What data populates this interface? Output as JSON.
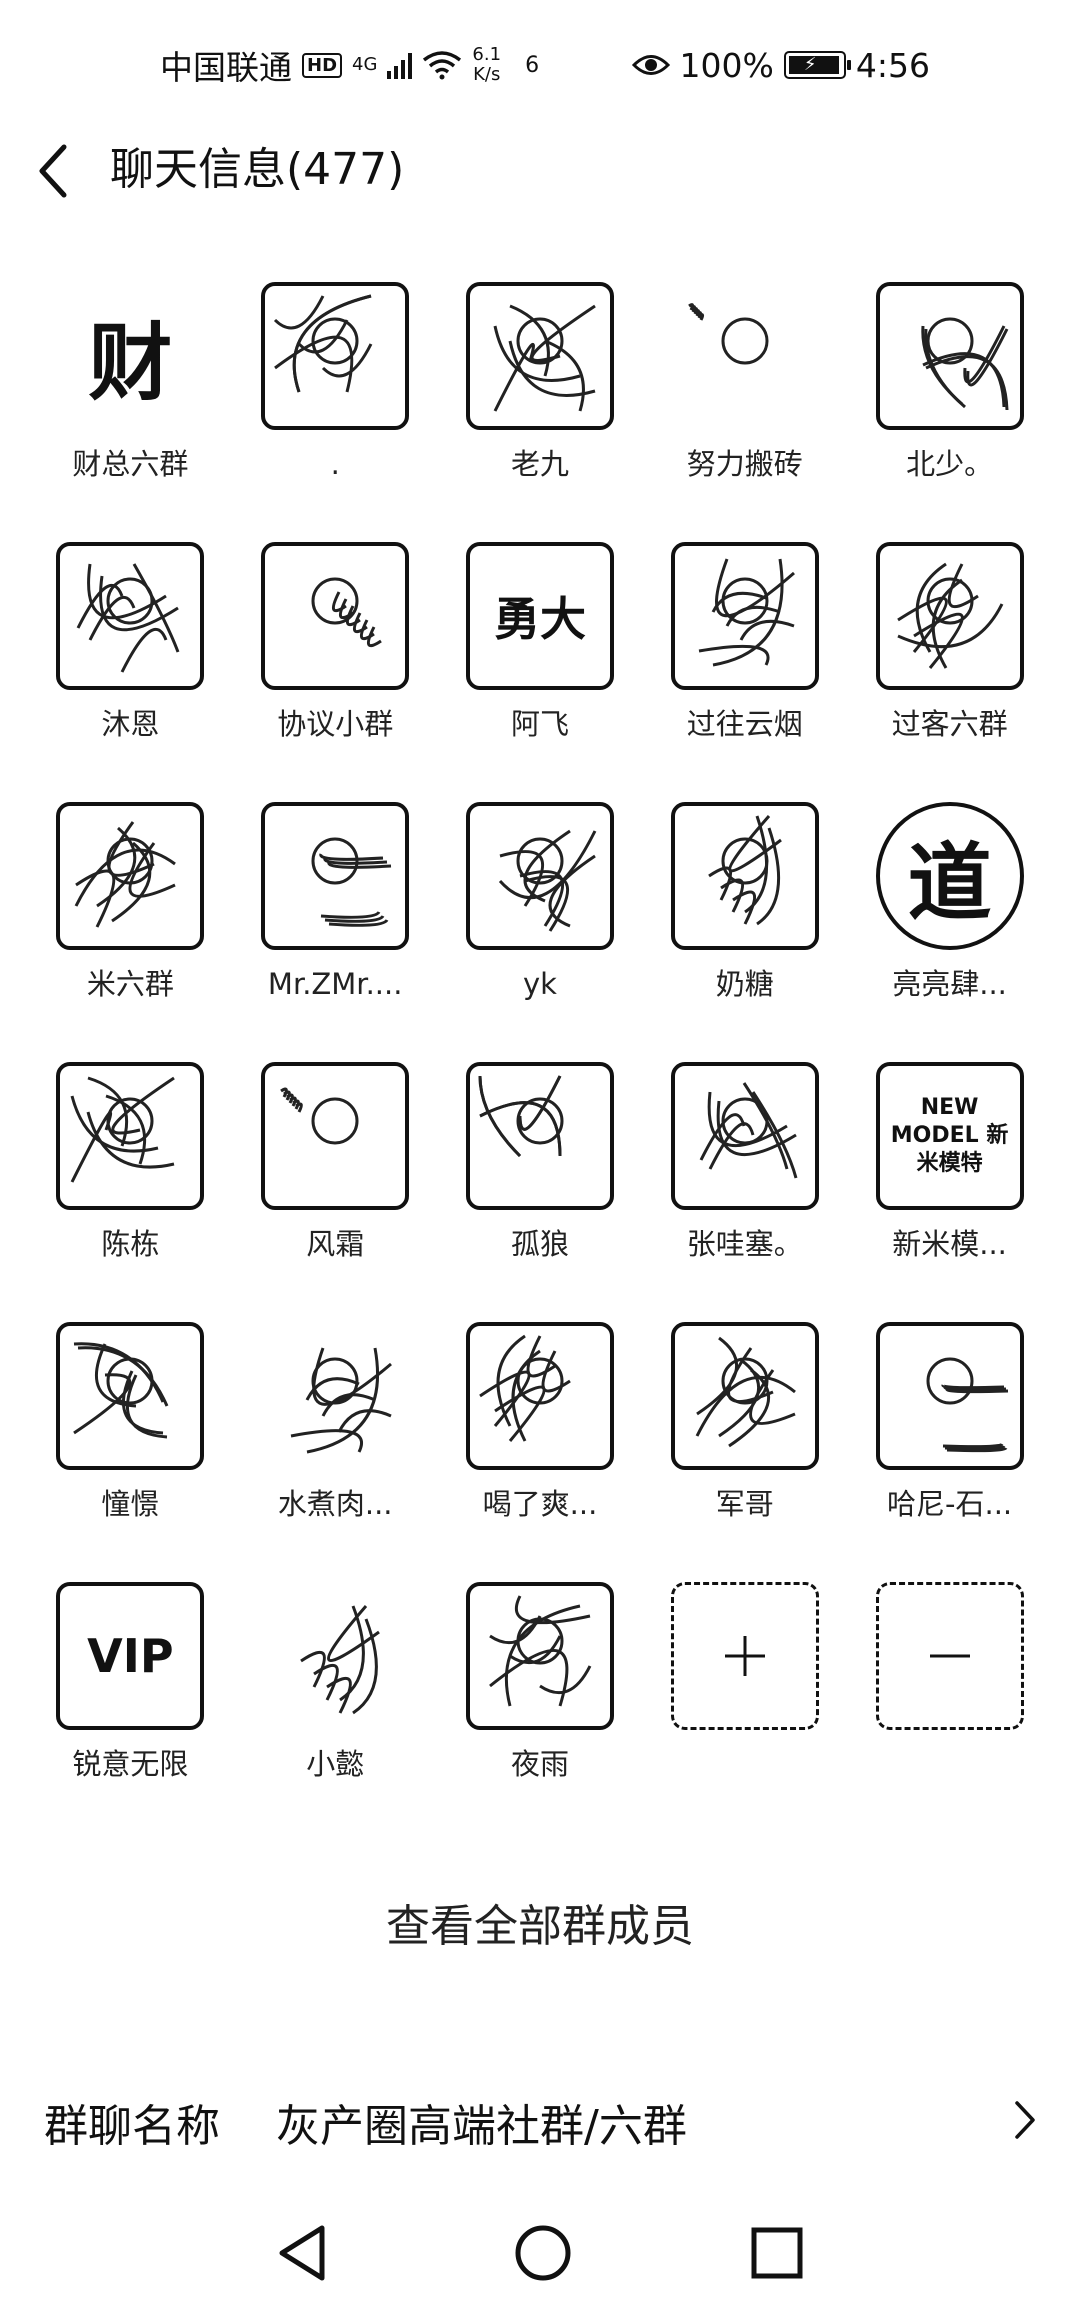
{
  "status_bar": {
    "carrier": "中国联通",
    "hd": "HD",
    "network": "4G",
    "speed_value": "6.1",
    "speed_unit": "K/s",
    "notification_count": "6",
    "battery_percent": "100%",
    "battery_level": 1.0,
    "time": "4:56"
  },
  "header": {
    "title": "聊天信息(477)"
  },
  "members": [
    {
      "name": "财总六群",
      "avatar_text": "财",
      "avatar_icon": "calligraphy-avatar-icon"
    },
    {
      "name": ".",
      "avatar_icon": "landscape-avatar-icon"
    },
    {
      "name": "老九",
      "avatar_icon": "street-photo-avatar-icon"
    },
    {
      "name": "努力搬砖",
      "avatar_icon": "baby-photo-avatar-icon"
    },
    {
      "name": "北少。",
      "avatar_icon": "pattern-avatar-icon"
    },
    {
      "name": "沐恩",
      "avatar_icon": "portrait-avatar-icon"
    },
    {
      "name": "协议小群",
      "avatar_icon": "calligraphy-avatar-icon"
    },
    {
      "name": "阿飞",
      "avatar_text": "勇大",
      "avatar_icon": "poster-avatar-icon"
    },
    {
      "name": "过往云烟",
      "avatar_icon": "crowd-photo-avatar-icon"
    },
    {
      "name": "过客六群",
      "avatar_icon": "landscape-avatar-icon"
    },
    {
      "name": "米六群",
      "avatar_icon": "geometric-avatar-icon"
    },
    {
      "name": "Mr.ZMr....",
      "avatar_icon": "sketch-avatar-icon"
    },
    {
      "name": "yk",
      "avatar_icon": "man-portrait-avatar-icon"
    },
    {
      "name": "奶糖",
      "avatar_icon": "child-with-bear-avatar-icon"
    },
    {
      "name": "亮亮肆...",
      "avatar_text": "道",
      "avatar_icon": "round-calligraphy-avatar-icon"
    },
    {
      "name": "陈栋",
      "avatar_icon": "man-glasses-avatar-icon"
    },
    {
      "name": "风霜",
      "avatar_icon": "eagle-avatar-icon"
    },
    {
      "name": "孤狼",
      "avatar_icon": "man-portrait-avatar-icon"
    },
    {
      "name": "张哇塞。",
      "avatar_icon": "cartoon-avatar-icon"
    },
    {
      "name": "新米模...",
      "avatar_text": "NEW MODEL 新米模特",
      "avatar_icon": "logo-avatar-icon"
    },
    {
      "name": "憧憬",
      "avatar_icon": "man-portrait-avatar-icon"
    },
    {
      "name": "水煮肉...",
      "avatar_icon": "cartoon-kid-avatar-icon"
    },
    {
      "name": "喝了爽...",
      "avatar_icon": "doraemon-avatar-icon"
    },
    {
      "name": "军哥",
      "avatar_icon": "smiling-man-avatar-icon"
    },
    {
      "name": "哈尼-石...",
      "avatar_icon": "beach-photo-avatar-icon"
    },
    {
      "name": "锐意无限",
      "avatar_text": "VIP",
      "avatar_icon": "vip-avatar-icon"
    },
    {
      "name": "小懿",
      "avatar_icon": "blank-avatar-icon"
    },
    {
      "name": "夜雨",
      "avatar_icon": "outdoor-photo-avatar-icon"
    }
  ],
  "actions": {
    "add_icon": "plus-icon",
    "remove_icon": "minus-icon",
    "view_all": "查看全部群成员"
  },
  "group_name": {
    "label": "群聊名称",
    "value": "灰产圈高端社群/六群"
  }
}
